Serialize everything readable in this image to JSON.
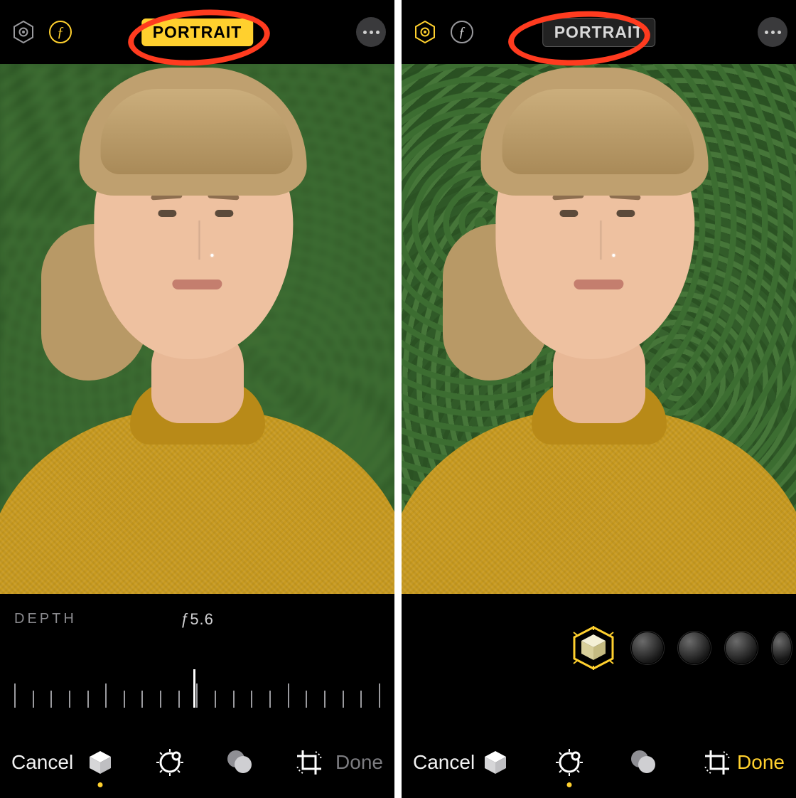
{
  "left": {
    "topbar": {
      "portrait_label": "PORTRAIT",
      "portrait_active": true,
      "lighting": {
        "icon": "hexagon-target-icon",
        "active": false
      },
      "aperture": {
        "icon": "f-stop-icon",
        "glyph": "ƒ",
        "active": true
      }
    },
    "depth": {
      "label": "DEPTH",
      "value": "ƒ5.6"
    },
    "tabbar": {
      "cancel": "Cancel",
      "done": "Done",
      "done_enabled": false,
      "tabs": {
        "portrait": "cube-icon",
        "adjust": "adjust-dial-icon",
        "filters": "filters-venn-icon",
        "crop": "crop-rotate-icon"
      },
      "selected_tab": "portrait"
    },
    "annotation": {
      "target": "portrait-badge",
      "shape": "ellipse",
      "color": "#ff3b1f"
    }
  },
  "right": {
    "topbar": {
      "portrait_label": "PORTRAIT",
      "portrait_active": false,
      "lighting": {
        "icon": "hexagon-target-icon",
        "active": true
      },
      "aperture": {
        "icon": "f-stop-icon",
        "glyph": "ƒ",
        "active": false
      }
    },
    "lighting_row": {
      "selected": 0,
      "options": [
        "natural-light",
        "studio-light",
        "contour-light",
        "stage-light",
        "stage-light-mono"
      ]
    },
    "tabbar": {
      "cancel": "Cancel",
      "done": "Done",
      "done_enabled": true,
      "tabs": {
        "portrait": "cube-icon",
        "adjust": "adjust-dial-icon",
        "filters": "filters-venn-icon",
        "crop": "crop-rotate-icon"
      },
      "selected_tab": "adjust"
    },
    "annotation": {
      "target": "portrait-badge",
      "shape": "ellipse",
      "color": "#ff3b1f"
    }
  },
  "icons": {
    "more": "more-icon"
  }
}
